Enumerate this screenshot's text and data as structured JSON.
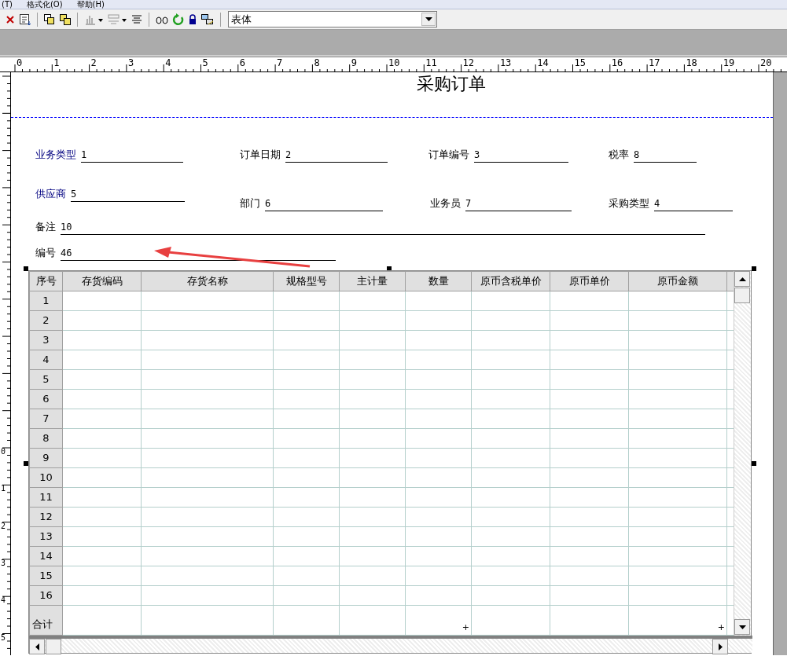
{
  "menu": [
    "(T)",
    "格式化(O)",
    "帮助(H)"
  ],
  "toolbar": {
    "style_select": {
      "value": "表体"
    }
  },
  "ruler": {
    "labels": [
      "0",
      "1",
      "2",
      "3",
      "4",
      "5",
      "6",
      "7",
      "8",
      "9",
      "10",
      "11",
      "12",
      "13",
      "14",
      "15",
      "16",
      "17",
      "18",
      "19",
      "20"
    ]
  },
  "vertical_ruler": {
    "labels": [
      "0",
      "1",
      "2",
      "3",
      "4",
      "5"
    ]
  },
  "report": {
    "title": "采购订单",
    "fields": [
      {
        "label": "业务类型",
        "value": "1",
        "required": true
      },
      {
        "label": "订单日期",
        "value": "2",
        "required": false
      },
      {
        "label": "订单编号",
        "value": "3",
        "required": false
      },
      {
        "label": "税率",
        "value": "8",
        "required": false
      },
      {
        "label": "供应商",
        "value": "5",
        "required": true
      },
      {
        "label": "部门",
        "value": "6",
        "required": false
      },
      {
        "label": "业务员",
        "value": "7",
        "required": false
      },
      {
        "label": "采购类型",
        "value": "4",
        "required": false
      },
      {
        "label": "备注",
        "value": "10",
        "required": false
      },
      {
        "label": "编号",
        "value": "46",
        "required": false
      }
    ],
    "table": {
      "columns": [
        {
          "label": "序号"
        },
        {
          "label": "存货编码"
        },
        {
          "label": "存货名称"
        },
        {
          "label": "规格型号"
        },
        {
          "label": "主计量"
        },
        {
          "label": "数量",
          "total_mark": "+"
        },
        {
          "label": "原币含税单价"
        },
        {
          "label": "原币单价"
        },
        {
          "label": "原币金额",
          "total_mark": "+"
        }
      ],
      "rows": [
        "1",
        "2",
        "3",
        "4",
        "5",
        "6",
        "7",
        "8",
        "9",
        "10",
        "11",
        "12",
        "13",
        "14",
        "15",
        "16"
      ],
      "total_label": "合计"
    }
  }
}
